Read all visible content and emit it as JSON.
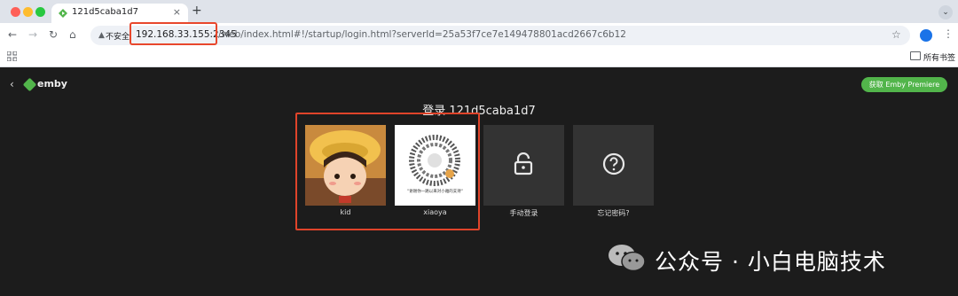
{
  "tab": {
    "title": "121d5caba1d7",
    "close_glyph": "×",
    "new_tab_glyph": "+"
  },
  "toolbar": {
    "back_glyph": "←",
    "forward_glyph": "→",
    "reload_glyph": "↻",
    "home_glyph": "⌂",
    "security_label": "不安全",
    "url_host": "192.168.33.155:2345",
    "url_rest": "/web/index.html#!/startup/login.html?serverId=25a53f7ce7e149478801acd2667c6b12",
    "star_glyph": "☆",
    "menu_glyph": "⋮"
  },
  "bookmarks": {
    "all_bookmarks": "所有书签"
  },
  "emby": {
    "back_glyph": "‹",
    "brand": "emby",
    "premiere_button": "获取 Emby Premiere",
    "login_title": "登录 121d5caba1d7",
    "users": [
      {
        "name": "kid"
      },
      {
        "name": "xiaoya",
        "qr_caption": "\"谢谢你一路以来对小雅的支持\""
      }
    ],
    "actions": [
      {
        "label": "手动登录",
        "icon": "lock-icon"
      },
      {
        "label": "忘记密码?",
        "icon": "question-icon"
      }
    ],
    "colors": {
      "accent": "#52b54b",
      "background": "#1c1c1c",
      "highlight": "#e0442a"
    }
  },
  "watermark": {
    "text": "公众号 · 小白电脑技术"
  }
}
